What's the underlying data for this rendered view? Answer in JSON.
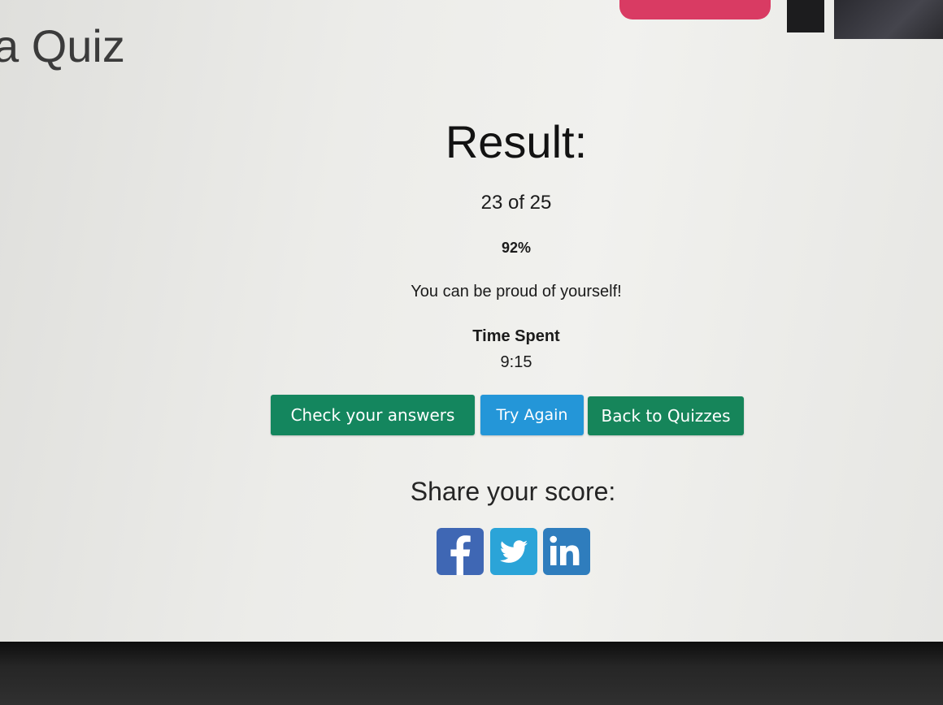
{
  "header": {
    "title": "a Quiz",
    "top_button_color": "#d93b63"
  },
  "result": {
    "heading": "Result:",
    "score": "23 of 25",
    "percent": "92%",
    "message": "You can be proud of yourself!",
    "time_label": "Time Spent",
    "time_value": "9:15"
  },
  "actions": {
    "check_answers": "Check your answers",
    "try_again": "Try Again",
    "back_to_quizzes": "Back to Quizzes",
    "colors": {
      "check_answers": "#14865e",
      "try_again": "#2496d8",
      "back_to_quizzes": "#16855a"
    }
  },
  "share": {
    "heading": "Share your score:",
    "networks": [
      {
        "icon": "facebook-icon",
        "color": "#3f67b4"
      },
      {
        "icon": "twitter-icon",
        "color": "#2ba4d8"
      },
      {
        "icon": "linkedin-icon",
        "color": "#2f7dbd"
      }
    ]
  }
}
